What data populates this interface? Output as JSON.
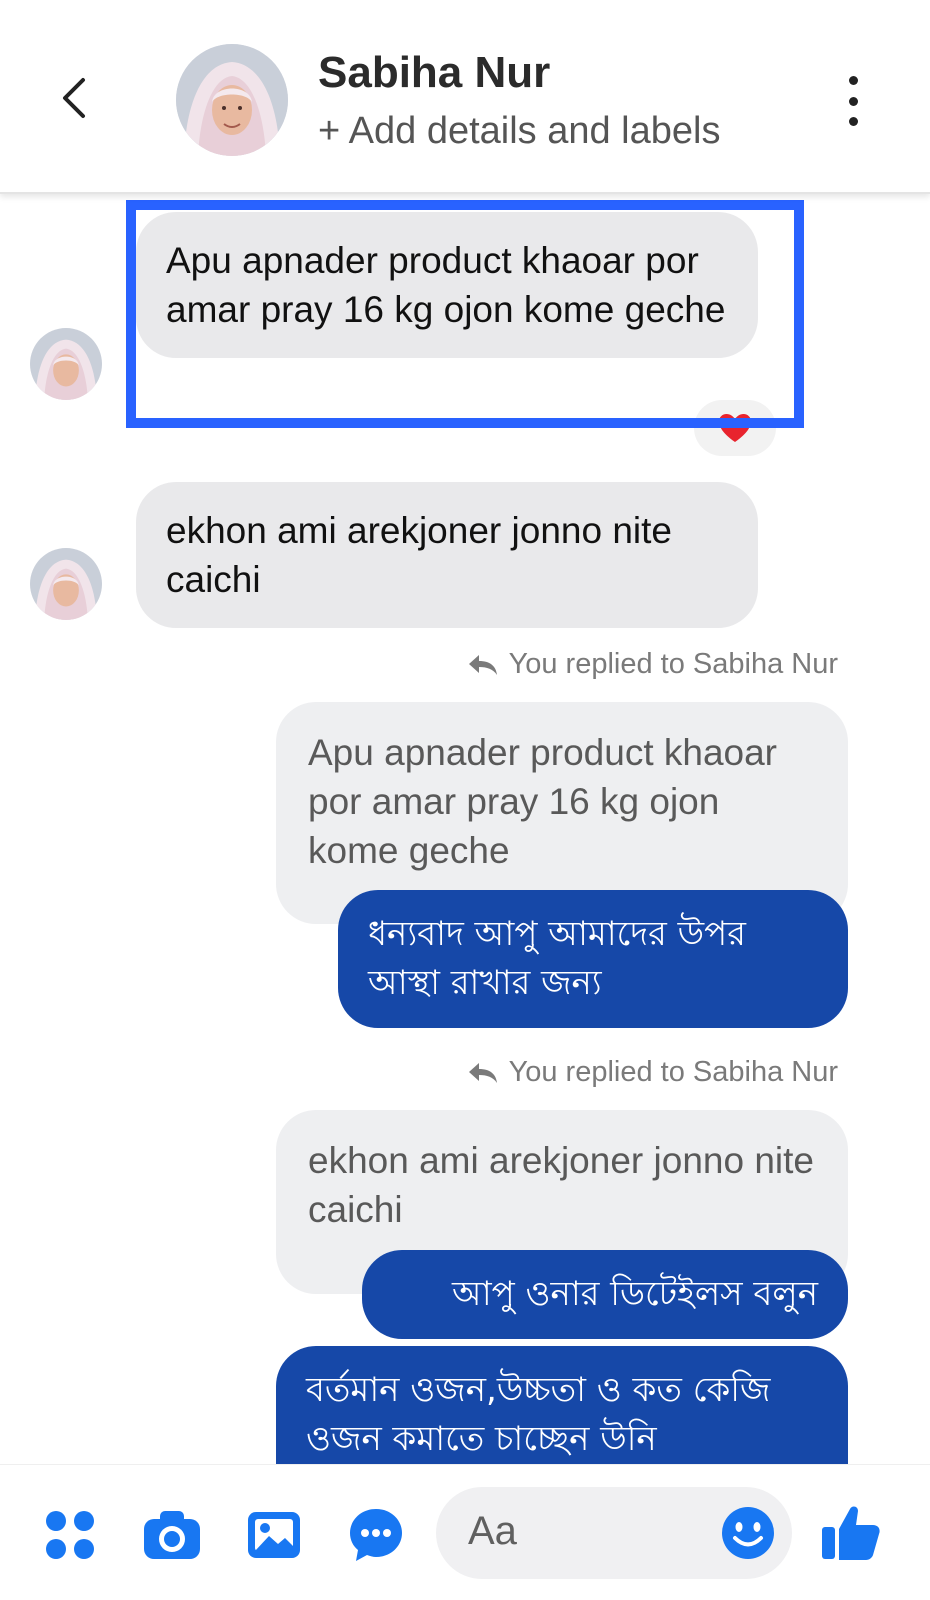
{
  "header": {
    "name": "Sabiha Nur",
    "subtitle": "+ Add details and labels"
  },
  "messages": {
    "incoming_1": "Apu apnader product khaoar por amar pray 16 kg ojon kome geche",
    "incoming_2": "ekhon ami arekjoner jonno nite caichi",
    "reply_note_1": "You replied to Sabiha Nur",
    "quoted_1": "Apu apnader product khaoar por amar pray 16 kg ojon kome geche",
    "outgoing_1": "ধন্যবাদ আপু আমাদের উপর আস্থা রাখার জন্য",
    "reply_note_2": "You replied to Sabiha Nur",
    "quoted_2": "ekhon ami arekjoner jonno nite caichi",
    "outgoing_2": "আপু ওনার ডিটেইলস বলুন",
    "outgoing_3": "বর্তমান ওজন,উচ্চতা ও কত কেজি ওজন কমাতে চাচ্ছেন উনি"
  },
  "reaction": "heart",
  "composer": {
    "placeholder": "Aa"
  },
  "toolbar_icons": [
    "apps-icon",
    "camera-icon",
    "gallery-icon",
    "chat-icon",
    "emoji-icon",
    "like-icon"
  ],
  "colors": {
    "accent": "#1877f2",
    "outgoing_bubble": "#1648a8",
    "highlight_box": "#2962ff",
    "incoming_bubble": "#e9e9eb"
  }
}
